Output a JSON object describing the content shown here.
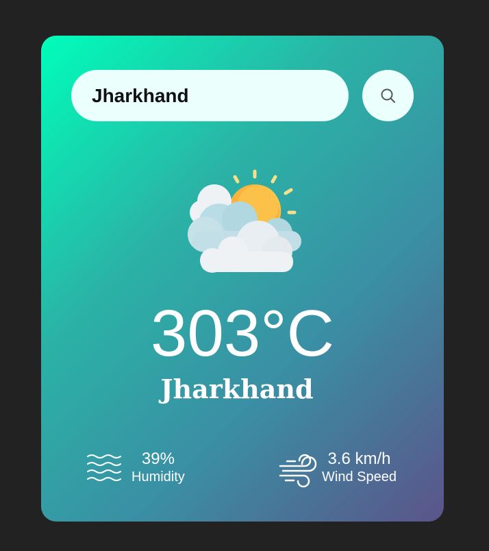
{
  "search": {
    "value": "Jharkhand"
  },
  "weather": {
    "temperature": "303°C",
    "city": "Jharkhand",
    "icon": "partly-cloudy-sun-icon"
  },
  "details": {
    "humidity": {
      "value": "39%",
      "label": "Humidity",
      "icon": "humidity-waves-icon"
    },
    "wind": {
      "value": "3.6 km/h",
      "label": "Wind Speed",
      "icon": "wind-icon"
    }
  },
  "colors": {
    "background": "#222222",
    "card_gradient_start": "#00feba",
    "card_gradient_end": "#5b548a",
    "input_background": "#ebfffc",
    "text": "#ffffff"
  }
}
